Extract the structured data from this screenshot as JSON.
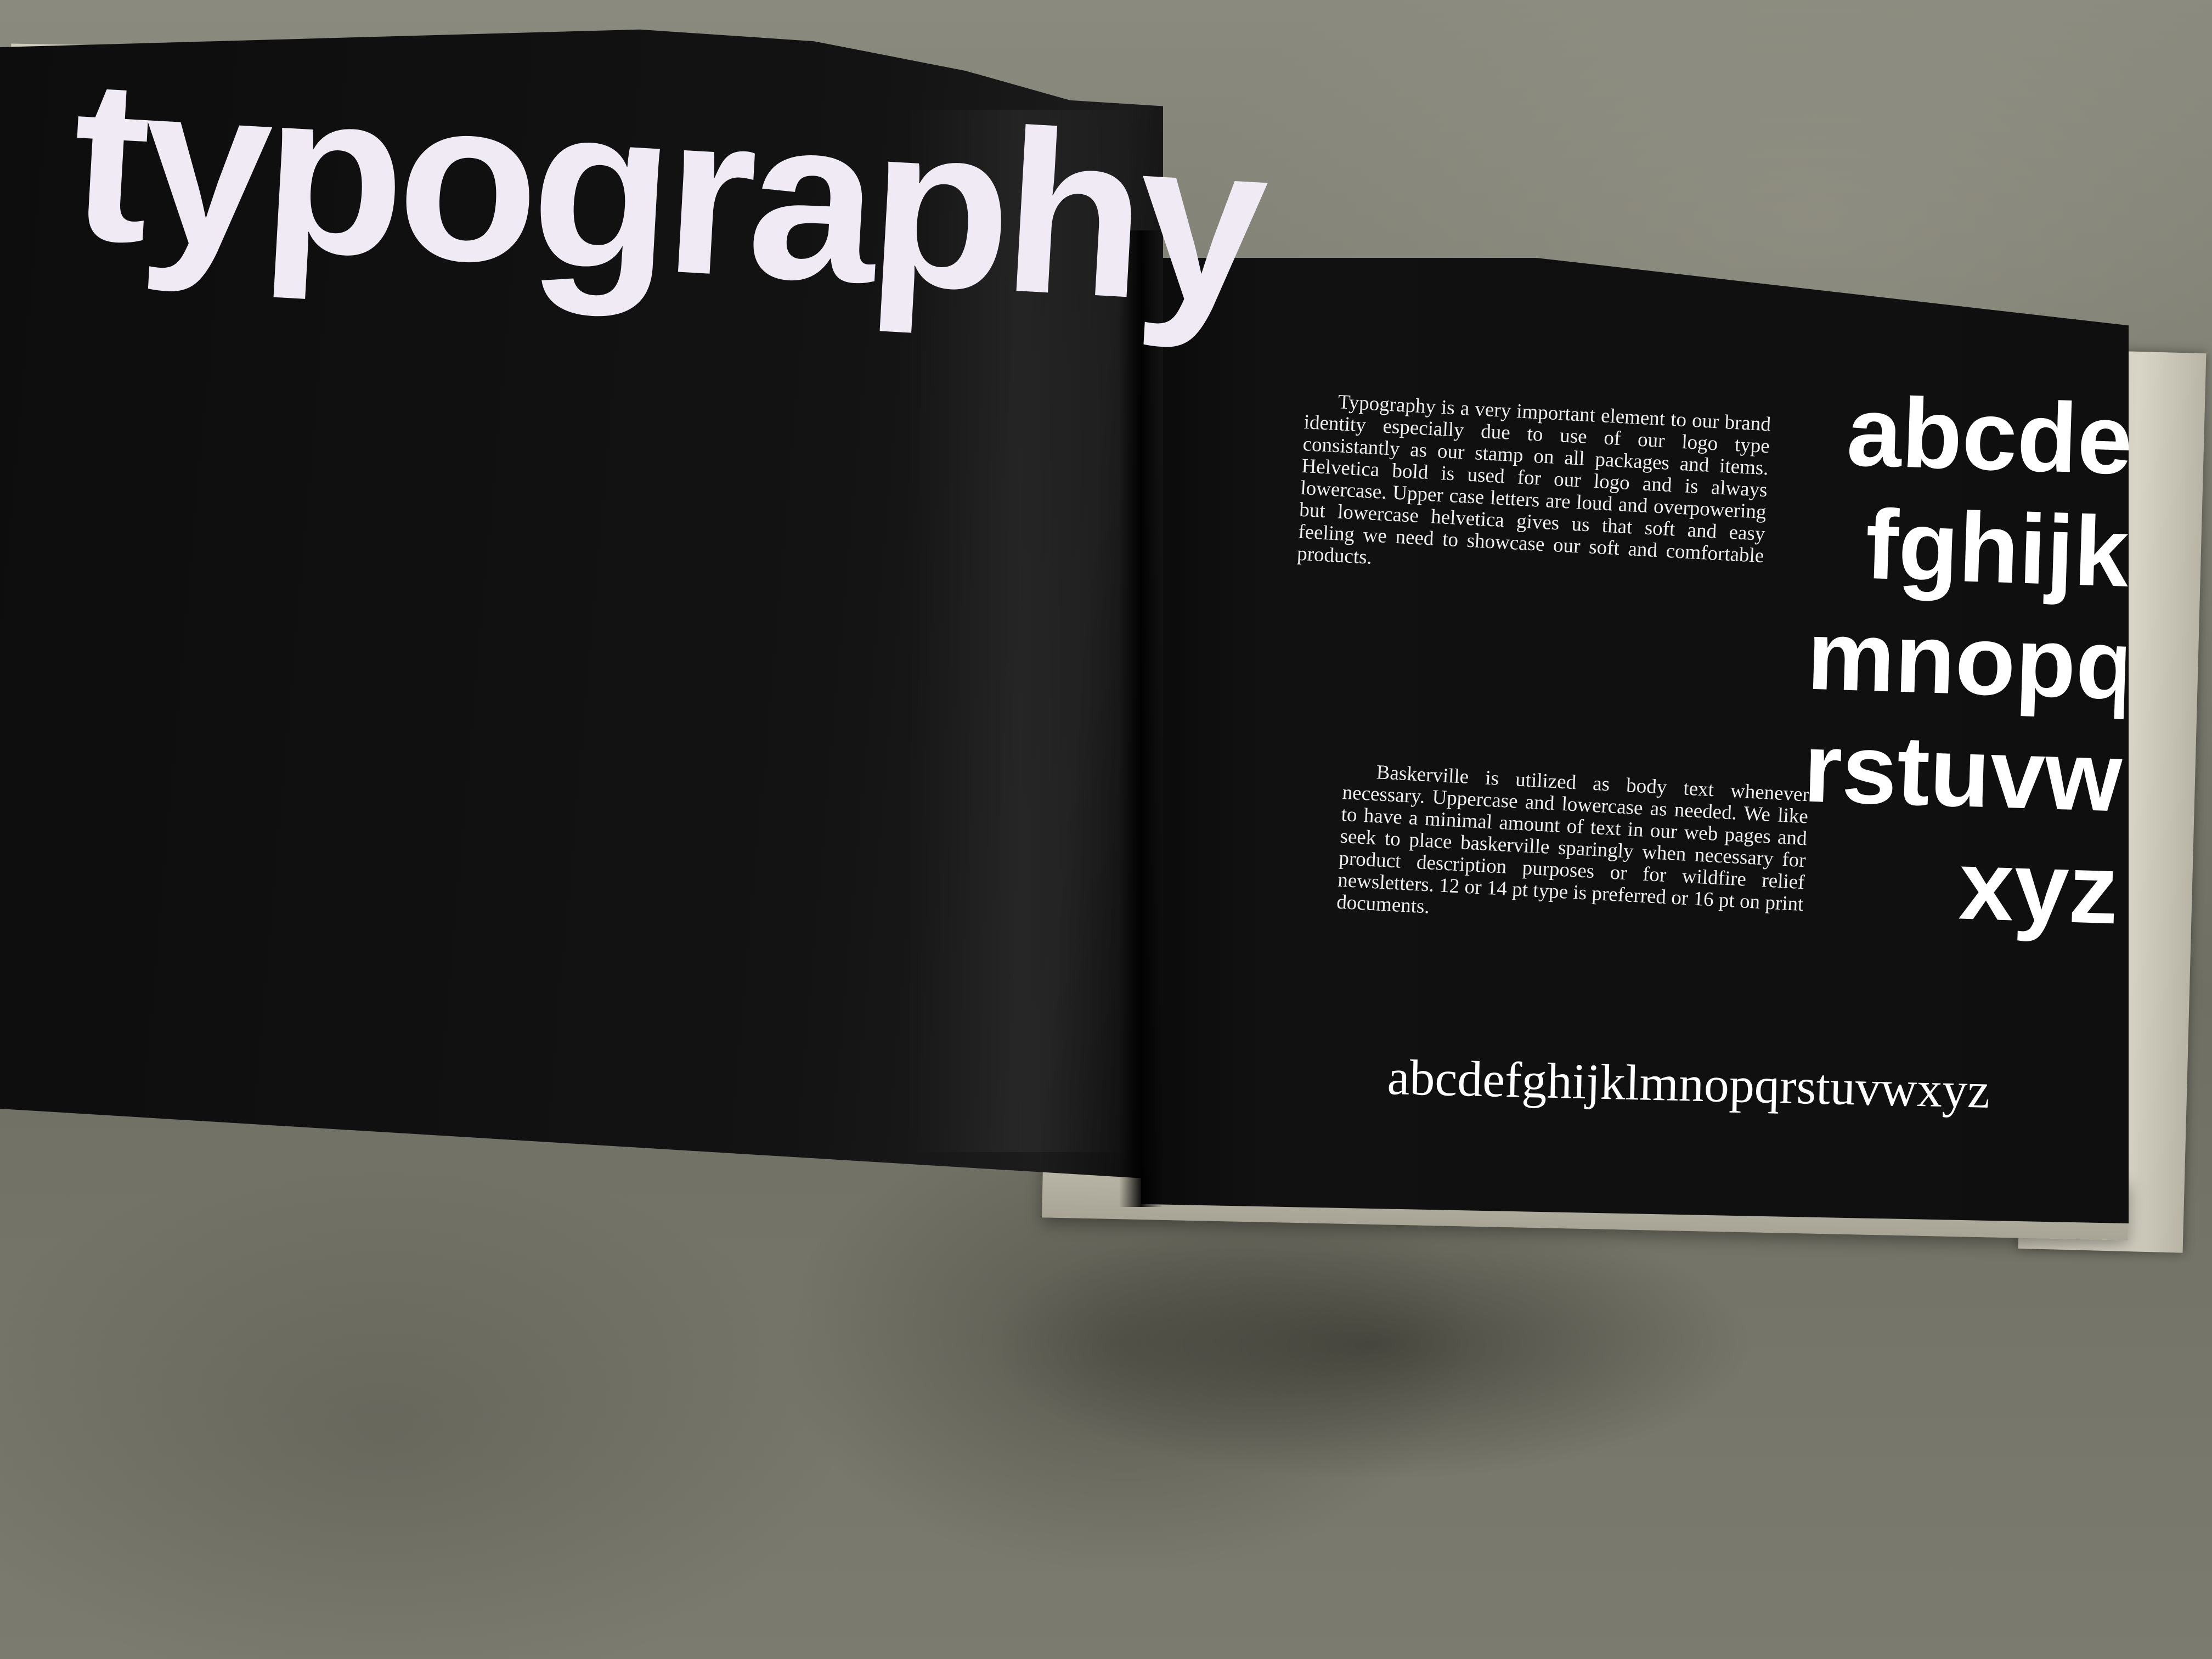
{
  "photo": {
    "subject": "brand-book-spread"
  },
  "left_page": {
    "headline": "typography"
  },
  "right_page": {
    "paragraph_1": "Typography is a very important element to our brand identity especially due to use of our logo type consistantly as our stamp on all packages and items. Helvetica bold is used for our logo and is always lowercase. Upper case letters are loud and overpowering but lowercase helvetica gives us that soft and easy feeling we need to showcase our soft and comfortable products.",
    "paragraph_2": "Baskerville is utilized as body text whenever necessary. Uppercase and lowercase as needed. We like to have a minimal amount of text in our web pages and seek to place baskerville sparingly when necessary for product description purposes or for wildfire relief newsletters. 12 or 14 pt type is preferred or 16 pt on print documents.",
    "sans_alphabet_lines": [
      "abcde",
      "fghijk",
      "mnopq",
      "rstuvw",
      "xyz"
    ],
    "serif_alphabet": "abcdefghijklmnopqrstuvwxyz"
  },
  "colors": {
    "page": "#0d0d0d",
    "text": "#ffffff",
    "floor": "#7a7a6e",
    "cover_cloth": "#d0ccbe"
  }
}
